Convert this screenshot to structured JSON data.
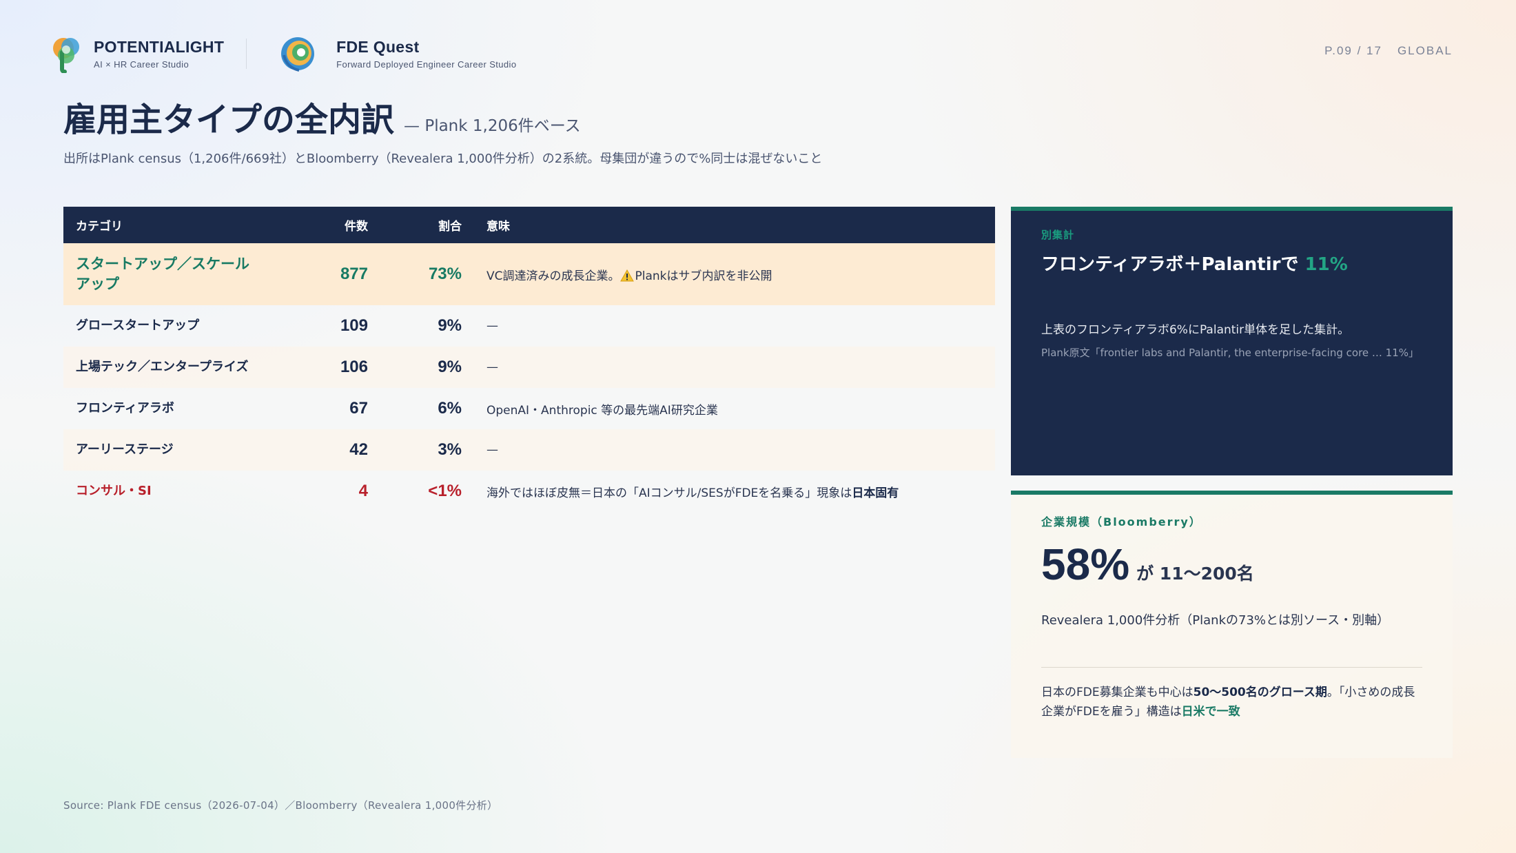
{
  "header": {
    "brand_name": "POTENTIALIGHT",
    "brand_sub": "AI × HR Career Studio",
    "product_name": "FDE Quest",
    "product_sub": "Forward Deployed Engineer Career Studio",
    "page_number": "P.09 / 17",
    "region": "GLOBAL"
  },
  "title": "雇用主タイプの全内訳",
  "title_sub": "— Plank 1,206件ベース",
  "subtitle": "出所はPlank census（1,206件/669社）とBloomberry（Revealera 1,000件分析）の2系統。母集団が違うので%同士は混ぜないこと",
  "table": {
    "headers": [
      "カテゴリ",
      "件数",
      "割合",
      "意味"
    ],
    "rows": [
      {
        "category": "スタートアップ／スケールアップ",
        "count": "877",
        "share": "73%",
        "meaning_pre": "VC調達済みの成長企業。",
        "meaning_post": "Plankはサブ内訳を非公開"
      },
      {
        "category": "グロースタートアップ",
        "count": "109",
        "share": "9%",
        "meaning": "—"
      },
      {
        "category": "上場テック／エンタープライズ",
        "count": "106",
        "share": "9%",
        "meaning": "—"
      },
      {
        "category": "フロンティアラボ",
        "count": "67",
        "share": "6%",
        "meaning": "OpenAI・Anthropic 等の最先端AI研究企業"
      },
      {
        "category": "アーリーステージ",
        "count": "42",
        "share": "3%",
        "meaning": "—"
      },
      {
        "category": "コンサル・SI",
        "count": "4",
        "share": "<1%",
        "meaning_pre": "海外ではほぼ皮無＝日本の「AIコンサル/SESがFDEを名乗る」現象は",
        "meaning_bold": "日本固有"
      }
    ]
  },
  "card_dark": {
    "kicker": "別集計",
    "heading_pre": "フロンティアラボ＋Palantirで",
    "heading_accent": "11%",
    "body": "上表のフロンティアラボ6%にPalantir単体を足した集計。",
    "note": "Plank原文「frontier labs and Palantir, the enterprise-facing core … 11%」"
  },
  "card_light": {
    "kicker": "企業規模（Bloomberry）",
    "big_value": "58%",
    "big_unit": "が 11〜200名",
    "desc": "Revealera 1,000件分析（Plankの73%とは別ソース・別軸）",
    "foot_1": "日本のFDE募集企業も中心は",
    "foot_bold": "50〜500名のグロース期",
    "foot_2": "。「小さめの成長企業がFDEを雇う」構造は",
    "foot_green": "日米で一致"
  },
  "source": "Source: Plank FDE census（2026-07-04）／Bloomberry（Revealera 1,000件分析）",
  "colors": {
    "navy": "#1b2a4a",
    "green": "#1a7a65",
    "red": "#b8202b",
    "highlight_row": "#fdebd3"
  }
}
